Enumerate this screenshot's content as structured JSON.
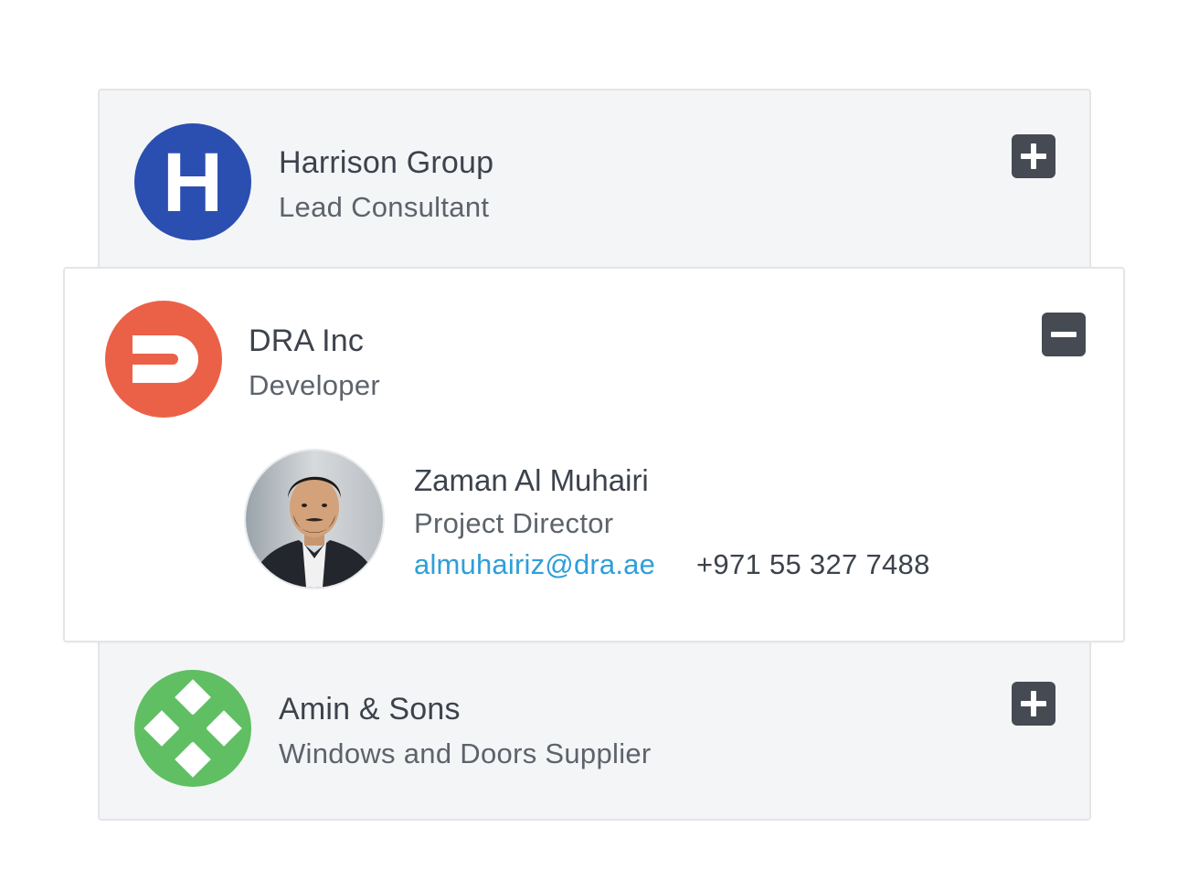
{
  "colors": {
    "harrison_logo": "#2b4fb0",
    "dra_logo": "#eb6148",
    "amin_logo": "#5fbf62",
    "toggle_button": "#454a53",
    "email_link": "#2f9ed9",
    "collapsed_card_bg": "#f4f5f7"
  },
  "companies": [
    {
      "name": "Harrison Group",
      "role": "Lead Consultant",
      "logo_letter": "H",
      "logo_icon": "harrison-h-logo",
      "toggle_icon": "plus-icon",
      "expanded": false
    },
    {
      "name": "DRA Inc",
      "role": "Developer",
      "logo_icon": "dra-d-logo",
      "toggle_icon": "minus-icon",
      "expanded": true,
      "contact": {
        "name": "Zaman Al Muhairi",
        "title": "Project Director",
        "email": "almuhairiz@dra.ae",
        "phone": "+971 55 327 7488",
        "photo_icon": "person-avatar"
      }
    },
    {
      "name": "Amin & Sons",
      "role": "Windows and Doors Supplier",
      "logo_icon": "amin-diamond-logo",
      "toggle_icon": "plus-icon",
      "expanded": false
    }
  ]
}
